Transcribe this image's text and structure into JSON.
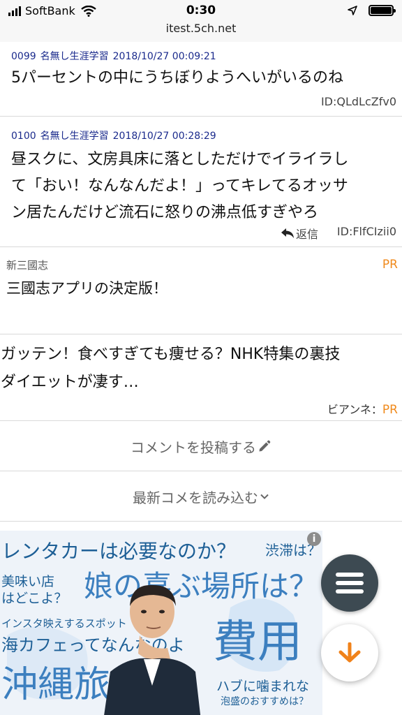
{
  "status_bar": {
    "carrier": "SoftBank",
    "time": "0:30",
    "url": "itest.5ch.net"
  },
  "posts": [
    {
      "number": "0099",
      "name": "名無し生涯学習",
      "date": "2018/10/27 00:09:21",
      "body": [
        "5パーセントの中にうちぼりようへいがいるのね"
      ],
      "id": "ID:QLdLcZfv0"
    },
    {
      "number": "0100",
      "name": "名無し生涯学習",
      "date": "2018/10/27 00:28:29",
      "body": [
        "昼スクに、文房具床に落としただけでイライラし",
        "て「おい！なんなんだよ！」ってキレてるオッサ",
        "ン居たんだけど流石に怒りの沸点低すぎやろ"
      ],
      "reply_label": "返信",
      "id": "ID:FlfCIzii0"
    }
  ],
  "ads": [
    {
      "source": "新三國志",
      "pr": "PR",
      "text": "三國志アプリの決定版！"
    },
    {
      "lines": [
        "ガッテン！食べすぎても痩せる？NHK特集の裏技",
        "ダイエットが凄す…"
      ],
      "source": "ビアンネ：",
      "pr": "PR"
    }
  ],
  "actions": {
    "post_comment": "コメントを投稿する",
    "load_latest": "最新コメを読み込む"
  },
  "banner": {
    "words": [
      "レンタカーは必要なのか？",
      "渋滞は？",
      "美味い店",
      "はどこよ？",
      "娘の喜ぶ場所は？",
      "インスタ映えするスポット",
      "海カフェってなんなのよ",
      "費用",
      "沖縄旅",
      "ハブに噛まれな",
      "泡盛のおすすめは？"
    ]
  },
  "colors": {
    "header_link": "#1a2a8c",
    "pr": "#f08a1c",
    "menu_fab": "#3d4a52"
  },
  "icons": {
    "reply": "reply-arrow-icon",
    "pencil": "pencil-icon",
    "chevron": "chevron-down-icon",
    "menu": "hamburger-menu-icon",
    "scroll_down": "arrow-down-icon",
    "info": "info-icon"
  }
}
